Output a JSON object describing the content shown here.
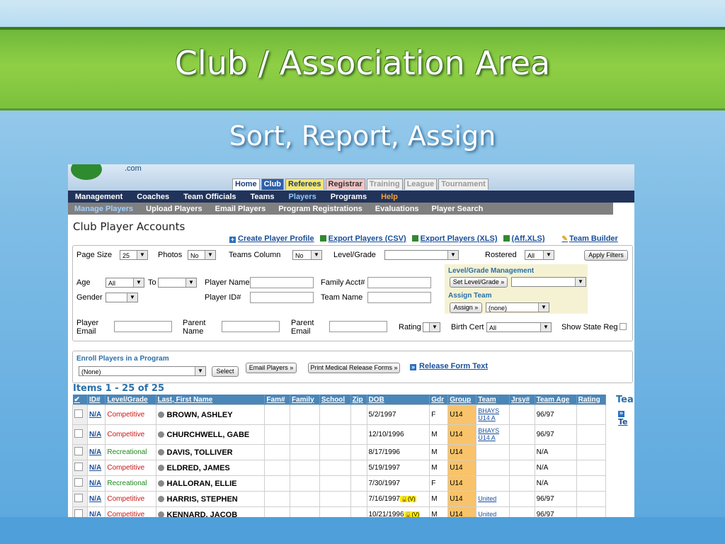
{
  "slide": {
    "title": "Club / Association Area",
    "subtitle": "Sort, Report, Assign"
  },
  "app": {
    "logo_suffix": ".com",
    "top_tabs": [
      "Home",
      "Club",
      "Referees",
      "Registrar",
      "Training",
      "League",
      "Tournament"
    ],
    "nav_primary": [
      "Management",
      "Coaches",
      "Team Officials",
      "Teams",
      "Players",
      "Programs",
      "Help"
    ],
    "nav_secondary": [
      "Manage Players",
      "Upload Players",
      "Email Players",
      "Program Registrations",
      "Evaluations",
      "Player Search"
    ]
  },
  "page": {
    "title": "Club Player Accounts",
    "actions": {
      "create": "Create Player Profile",
      "export_csv": "Export Players (CSV)",
      "export_xls": "Export Players (XLS)",
      "aff_xls": "(Aff.XLS)",
      "team_builder": "Team Builder"
    }
  },
  "filters": {
    "page_size_label": "Page Size",
    "page_size": "25",
    "photos_label": "Photos",
    "photos": "No",
    "teams_column_label": "Teams Column",
    "teams_column": "No",
    "level_label": "Level/Grade",
    "rostered_label": "Rostered",
    "rostered": "All",
    "apply": "Apply Filters",
    "age_label": "Age",
    "age": "All",
    "to_label": "To",
    "gender_label": "Gender",
    "player_name_label": "Player Name",
    "player_id_label": "Player ID#",
    "family_acct_label": "Family Acct#",
    "team_name_label": "Team Name",
    "player_email_label_1": "Player",
    "player_email_label_2": "Email",
    "parent_name_label_1": "Parent",
    "parent_name_label_2": "Name",
    "parent_email_label_1": "Parent",
    "parent_email_label_2": "Email",
    "rating_label": "Rating",
    "birth_cert_label": "Birth Cert",
    "birth_cert": "All",
    "show_state_reg_label": "Show State Reg",
    "level_mgmt_title": "Level/Grade Management",
    "set_level_button": "Set Level/Grade »",
    "assign_team_title": "Assign Team",
    "assign_button": "Assign »",
    "assign_team_value": "(none)"
  },
  "enroll": {
    "title": "Enroll Players in a Program",
    "program_value": "(None)",
    "select_button": "Select",
    "email_button": "Email Players »",
    "medical_button": "Print Medical Release Forms »",
    "release_link": "Release Form Text"
  },
  "grid": {
    "items_label": "Items 1 - 25 of 25",
    "side_header": "Tea",
    "side_link": "Te",
    "columns": [
      "✔",
      "ID#",
      "Level/Grade",
      "Last, First Name",
      "Fam#",
      "Family",
      "School",
      "Zip",
      "DOB",
      "Gdr",
      "Group",
      "Team",
      "Jrsy#",
      "Team Age",
      "Rating"
    ],
    "rows": [
      {
        "id": "N/A",
        "level": "Competitive",
        "name": "BROWN, ASHLEY",
        "dob": "5/2/1997",
        "lock": "",
        "gdr": "F",
        "group": "U14",
        "team": "BHAYS U14 A",
        "team_age": "96/97"
      },
      {
        "id": "N/A",
        "level": "Competitive",
        "name": "CHURCHWELL, GABE",
        "dob": "12/10/1996",
        "lock": "",
        "gdr": "M",
        "group": "U14",
        "team": "BHAYS U14 A",
        "team_age": "96/97"
      },
      {
        "id": "N/A",
        "level": "Recreational",
        "name": "DAVIS, TOLLIVER",
        "dob": "8/17/1996",
        "lock": "",
        "gdr": "M",
        "group": "U14",
        "team": "",
        "team_age": "N/A"
      },
      {
        "id": "N/A",
        "level": "Competitive",
        "name": "ELDRED, JAMES",
        "dob": "5/19/1997",
        "lock": "",
        "gdr": "M",
        "group": "U14",
        "team": "",
        "team_age": "N/A"
      },
      {
        "id": "N/A",
        "level": "Recreational",
        "name": "HALLORAN, ELLIE",
        "dob": "7/30/1997",
        "lock": "",
        "gdr": "F",
        "group": "U14",
        "team": "",
        "team_age": "N/A"
      },
      {
        "id": "N/A",
        "level": "Competitive",
        "name": "HARRIS, STEPHEN",
        "dob": "7/16/1997",
        "lock": "(V)",
        "gdr": "M",
        "group": "U14",
        "team": "United",
        "team_age": "96/97"
      },
      {
        "id": "N/A",
        "level": "Competitive",
        "name": "KENNARD, JACOB",
        "dob": "10/21/1996",
        "lock": "(V)",
        "gdr": "M",
        "group": "U14",
        "team": "United",
        "team_age": "96/97"
      }
    ]
  }
}
